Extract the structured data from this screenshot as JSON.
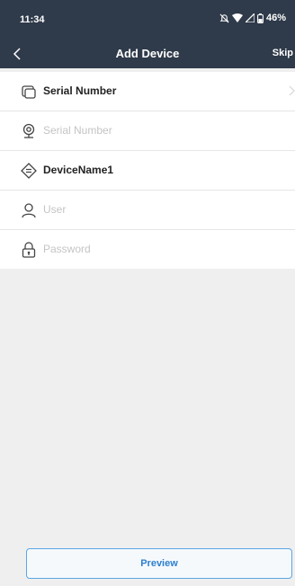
{
  "status_bar": {
    "time": "11:34",
    "battery": "46%"
  },
  "header": {
    "title": "Add Device",
    "skip_label": "Skip"
  },
  "form": {
    "items": [
      {
        "label": "Serial Number"
      },
      {
        "placeholder": "Serial Number"
      },
      {
        "value": "DeviceName1"
      },
      {
        "placeholder": "User"
      },
      {
        "placeholder": "Password"
      }
    ]
  },
  "footer": {
    "preview_label": "Preview"
  },
  "colors": {
    "header_bg": "#2f3a4a",
    "accent": "#2c7fcf",
    "page_bg": "#efefef"
  }
}
